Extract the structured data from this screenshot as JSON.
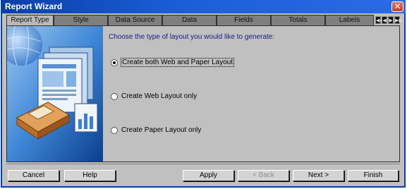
{
  "window": {
    "title": "Report Wizard",
    "close_glyph": "✕"
  },
  "tabs": [
    {
      "label": "Report Type",
      "active": true
    },
    {
      "label": "Style"
    },
    {
      "label": "Data Source"
    },
    {
      "label": "Data"
    },
    {
      "label": "Fields"
    },
    {
      "label": "Totals"
    },
    {
      "label": "Labels"
    }
  ],
  "tab_scroll": {
    "first": "◀◀",
    "prev": "◀",
    "next": "▶",
    "last": "▶▶"
  },
  "main": {
    "prompt": "Choose the type of layout you would like to generate:",
    "options": [
      {
        "label": "Create both Web and Paper Layout",
        "checked": true
      },
      {
        "label": "Create Web Layout only",
        "checked": false
      },
      {
        "label": "Create Paper Layout only",
        "checked": false
      }
    ]
  },
  "buttons": {
    "cancel": "Cancel",
    "help": "Help",
    "apply": "Apply",
    "back": "< Back",
    "next": "Next >",
    "finish": "Finish"
  }
}
